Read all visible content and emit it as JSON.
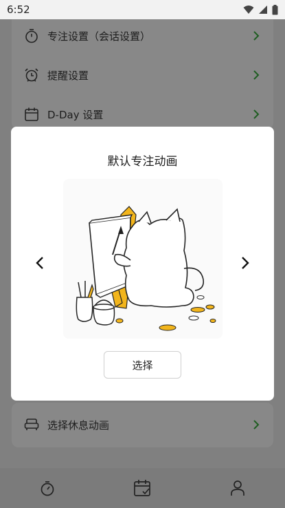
{
  "status_bar": {
    "time": "6:52"
  },
  "settings": {
    "items": [
      {
        "label": "专注设置（会话设置）",
        "icon": "timer-icon"
      },
      {
        "label": "提醒设置",
        "icon": "alarm-clock-icon"
      },
      {
        "label": "D-Day 设置",
        "icon": "calendar-icon"
      },
      {
        "label": "选择休息动画",
        "icon": "sofa-icon"
      }
    ]
  },
  "modal": {
    "title": "默认专注动画",
    "select_label": "选择",
    "illustration": "cat-painting-illustration"
  },
  "bottom_nav": {
    "items": [
      {
        "icon": "timer-icon"
      },
      {
        "icon": "calendar-check-icon"
      },
      {
        "icon": "person-icon"
      }
    ]
  },
  "colors": {
    "accent": "#2e7d32",
    "overlay": "#808080",
    "paint_yellow": "#f2b51c"
  }
}
